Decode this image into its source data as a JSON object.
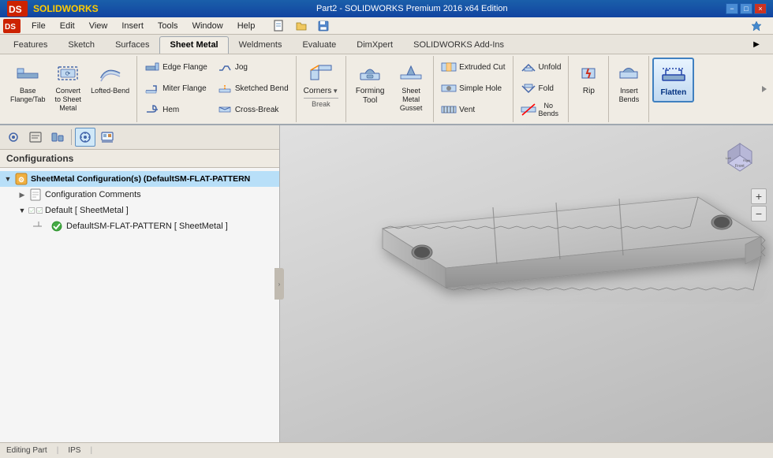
{
  "titleBar": {
    "title": "Part2 - SOLIDWORKS Premium 2016 x64 Edition",
    "minimize": "−",
    "maximize": "□",
    "close": "×"
  },
  "menuBar": {
    "items": [
      "File",
      "Edit",
      "View",
      "Insert",
      "Tools",
      "Window",
      "Help"
    ]
  },
  "ribbon": {
    "tabs": [
      {
        "label": "Features",
        "active": false
      },
      {
        "label": "Sketch",
        "active": false
      },
      {
        "label": "Surfaces",
        "active": false
      },
      {
        "label": "Sheet Metal",
        "active": true
      },
      {
        "label": "Weldments",
        "active": false
      },
      {
        "label": "Evaluate",
        "active": false
      },
      {
        "label": "DimXpert",
        "active": false
      },
      {
        "label": "SOLIDWORKS Add-Ins",
        "active": false
      }
    ],
    "groups": {
      "sheetMetal": [
        {
          "id": "base-flange",
          "label": "Base\nFlange/Tab",
          "icon": "base-flange"
        },
        {
          "id": "convert",
          "label": "Convert\nto Sheet\nMetal",
          "icon": "convert"
        },
        {
          "id": "lofted-bend",
          "label": "Lofted-Bend",
          "icon": "lofted-bend"
        }
      ],
      "flanges": [
        {
          "id": "edge-flange",
          "label": "Edge Flange",
          "icon": "edge-flange"
        },
        {
          "id": "miter-flange",
          "label": "Miter Flange",
          "icon": "miter-flange"
        },
        {
          "id": "hem",
          "label": "Hem",
          "icon": "hem"
        },
        {
          "id": "jog",
          "label": "Jog",
          "icon": "jog"
        },
        {
          "id": "sketched-bend",
          "label": "Sketched Bend",
          "icon": "sketched-bend"
        },
        {
          "id": "cross-break",
          "label": "Cross-Break",
          "icon": "cross-break"
        }
      ],
      "corners": {
        "id": "corners",
        "label": "Corners",
        "break": {
          "label": "Break",
          "icon": "break"
        }
      },
      "formingTool": {
        "id": "forming-tool",
        "label": "Forming\nTool",
        "icon": "forming-tool"
      },
      "otherLarge": [
        {
          "id": "sheet-metal-gusset",
          "label": "Sheet\nMetal\nGusset",
          "icon": "gusset"
        }
      ],
      "features": [
        {
          "id": "extruded-cutout",
          "label": "Extruded Cutout",
          "icon": "extruded-cut"
        },
        {
          "id": "simple-hole",
          "label": "Simple Hole",
          "icon": "simple-hole"
        },
        {
          "id": "vent",
          "label": "Vent",
          "icon": "vent"
        }
      ],
      "bend": [
        {
          "id": "unfold",
          "label": "Unfold",
          "icon": "unfold"
        },
        {
          "id": "fold",
          "label": "Fold",
          "icon": "fold"
        },
        {
          "id": "no-bends",
          "label": "No\nBends",
          "icon": "no-bends"
        }
      ],
      "rip": [
        {
          "id": "rip",
          "label": "Rip",
          "icon": "rip"
        }
      ],
      "insertBends": [
        {
          "id": "insert-bends",
          "label": "Insert\nBends",
          "icon": "insert-bends"
        }
      ],
      "flatten": {
        "id": "flatten",
        "label": "Flatten",
        "active": true
      }
    }
  },
  "leftPanel": {
    "toolbarBtns": [
      {
        "id": "motion",
        "icon": "motion",
        "active": false
      },
      {
        "id": "list",
        "icon": "list",
        "active": false
      },
      {
        "id": "config",
        "icon": "config",
        "active": false
      },
      {
        "id": "target",
        "icon": "target",
        "active": true
      },
      {
        "id": "chart",
        "icon": "chart",
        "active": false
      }
    ],
    "header": "Configurations",
    "tree": [
      {
        "id": "root",
        "label": "SheetMetal Configuration(s)  (DefaultSM-FLAT-PATTERN",
        "icon": "gear-yellow",
        "expanded": true,
        "level": 0,
        "children": [
          {
            "id": "config-comments",
            "label": "Configuration Comments",
            "icon": "document",
            "expanded": false,
            "level": 1
          },
          {
            "id": "default",
            "label": "Default [ SheetMetal ]",
            "icon": "config-item",
            "expanded": true,
            "level": 1,
            "cursor": true,
            "children": [
              {
                "id": "default-sm",
                "label": "DefaultSM-FLAT-PATTERN [ SheetMetal ]",
                "icon": "check-green",
                "level": 2
              }
            ]
          }
        ]
      }
    ]
  },
  "statusBar": {
    "items": [
      "Editing Part",
      "IPS",
      ""
    ]
  }
}
